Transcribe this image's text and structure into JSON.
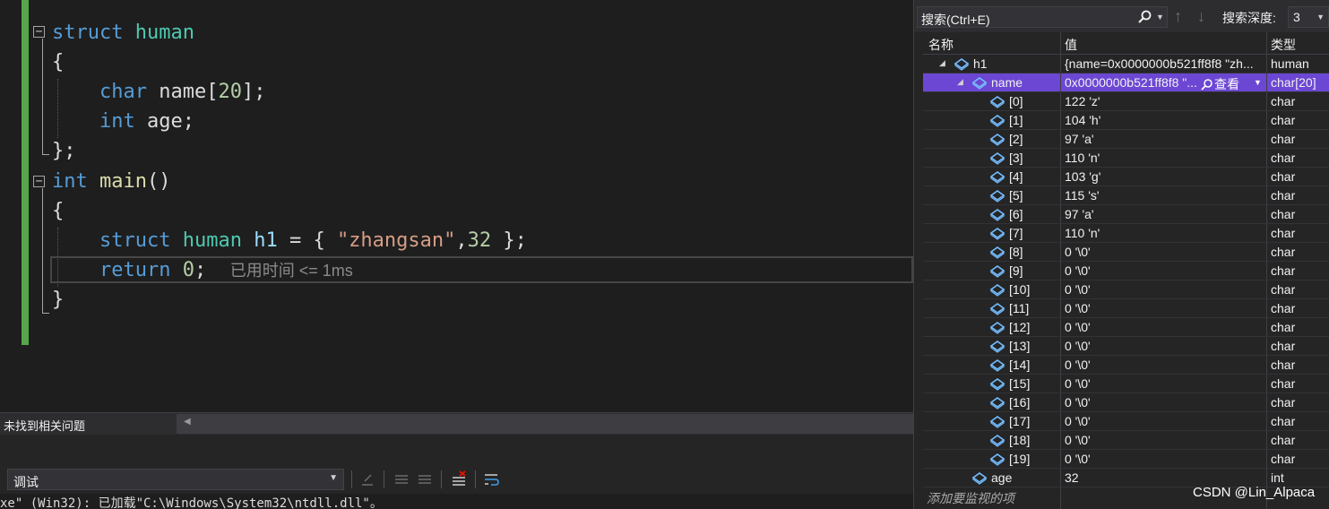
{
  "editor": {
    "lines": [
      {
        "id": "l1",
        "tokens": [
          {
            "t": "struct",
            "c": "kw"
          },
          {
            "t": " "
          },
          {
            "t": "human",
            "c": "ty"
          }
        ]
      },
      {
        "id": "l2",
        "tokens": [
          {
            "t": "{"
          }
        ]
      },
      {
        "id": "l3",
        "tokens": [
          {
            "t": "    "
          },
          {
            "t": "char",
            "c": "kw"
          },
          {
            "t": " name["
          },
          {
            "t": "20",
            "c": "num"
          },
          {
            "t": "];"
          }
        ]
      },
      {
        "id": "l4",
        "tokens": [
          {
            "t": "    "
          },
          {
            "t": "int",
            "c": "kw"
          },
          {
            "t": " age;"
          }
        ]
      },
      {
        "id": "l5",
        "tokens": [
          {
            "t": "};"
          }
        ]
      },
      {
        "id": "l6",
        "tokens": [
          {
            "t": "int",
            "c": "kw"
          },
          {
            "t": " "
          },
          {
            "t": "main",
            "c": "fn"
          },
          {
            "t": "()"
          }
        ]
      },
      {
        "id": "l7",
        "tokens": [
          {
            "t": "{"
          }
        ]
      },
      {
        "id": "l8",
        "tokens": [
          {
            "t": "    "
          },
          {
            "t": "struct",
            "c": "kw"
          },
          {
            "t": " "
          },
          {
            "t": "human",
            "c": "ty"
          },
          {
            "t": " "
          },
          {
            "t": "h1",
            "c": "var"
          },
          {
            "t": " = { "
          },
          {
            "t": "\"zhangsan\"",
            "c": "str"
          },
          {
            "t": ","
          },
          {
            "t": "32",
            "c": "num"
          },
          {
            "t": " };"
          }
        ]
      },
      {
        "id": "l9",
        "tokens": [
          {
            "t": "    "
          },
          {
            "t": "return",
            "c": "kw"
          },
          {
            "t": " "
          },
          {
            "t": "0",
            "c": "num"
          },
          {
            "t": ";  "
          },
          {
            "t": "已用时间 <= 1ms",
            "c": "perf"
          }
        ]
      },
      {
        "id": "l10",
        "tokens": [
          {
            "t": "}"
          }
        ]
      }
    ],
    "collapse_symbol": "−"
  },
  "error_list": {
    "status": "未找到相关问题"
  },
  "output": {
    "source_label": "调试",
    "last_line": "xe\" (Win32): 已加载\"C:\\Windows\\System32\\ntdll.dll\"。"
  },
  "watch": {
    "search_placeholder": "搜索(Ctrl+E)",
    "depth_label": "搜索深度:",
    "depth_value": "3",
    "columns": {
      "name": "名称",
      "value": "值",
      "type": "类型"
    },
    "view_label": "查看",
    "add_watch": "添加要监视的项",
    "rows": [
      {
        "name": "h1",
        "value": "{name=0x0000000b521ff8f8 \"zh...",
        "type": "human",
        "level": 0,
        "expanded": true
      },
      {
        "name": "name",
        "value": "0x0000000b521ff8f8 \"...",
        "type": "char[20]",
        "level": 1,
        "expanded": true,
        "selected": true
      },
      {
        "name": "[0]",
        "value": "122 'z'",
        "type": "char",
        "level": 2
      },
      {
        "name": "[1]",
        "value": "104 'h'",
        "type": "char",
        "level": 2
      },
      {
        "name": "[2]",
        "value": "97 'a'",
        "type": "char",
        "level": 2
      },
      {
        "name": "[3]",
        "value": "110 'n'",
        "type": "char",
        "level": 2
      },
      {
        "name": "[4]",
        "value": "103 'g'",
        "type": "char",
        "level": 2
      },
      {
        "name": "[5]",
        "value": "115 's'",
        "type": "char",
        "level": 2
      },
      {
        "name": "[6]",
        "value": "97 'a'",
        "type": "char",
        "level": 2
      },
      {
        "name": "[7]",
        "value": "110 'n'",
        "type": "char",
        "level": 2
      },
      {
        "name": "[8]",
        "value": "0 '\\0'",
        "type": "char",
        "level": 2
      },
      {
        "name": "[9]",
        "value": "0 '\\0'",
        "type": "char",
        "level": 2
      },
      {
        "name": "[10]",
        "value": "0 '\\0'",
        "type": "char",
        "level": 2
      },
      {
        "name": "[11]",
        "value": "0 '\\0'",
        "type": "char",
        "level": 2
      },
      {
        "name": "[12]",
        "value": "0 '\\0'",
        "type": "char",
        "level": 2
      },
      {
        "name": "[13]",
        "value": "0 '\\0'",
        "type": "char",
        "level": 2
      },
      {
        "name": "[14]",
        "value": "0 '\\0'",
        "type": "char",
        "level": 2
      },
      {
        "name": "[15]",
        "value": "0 '\\0'",
        "type": "char",
        "level": 2
      },
      {
        "name": "[16]",
        "value": "0 '\\0'",
        "type": "char",
        "level": 2
      },
      {
        "name": "[17]",
        "value": "0 '\\0'",
        "type": "char",
        "level": 2
      },
      {
        "name": "[18]",
        "value": "0 '\\0'",
        "type": "char",
        "level": 2
      },
      {
        "name": "[19]",
        "value": "0 '\\0'",
        "type": "char",
        "level": 2
      },
      {
        "name": "age",
        "value": "32",
        "type": "int",
        "level": 1
      }
    ]
  },
  "watermark": "CSDN @Lin_Alpaca",
  "colors": {
    "selection": "#6c47d3",
    "keyword": "#569cd6",
    "type": "#4ec9b0",
    "function": "#dcdcaa",
    "number": "#b5cea8",
    "string": "#d69d85",
    "changed_bar": "#57a64a"
  }
}
